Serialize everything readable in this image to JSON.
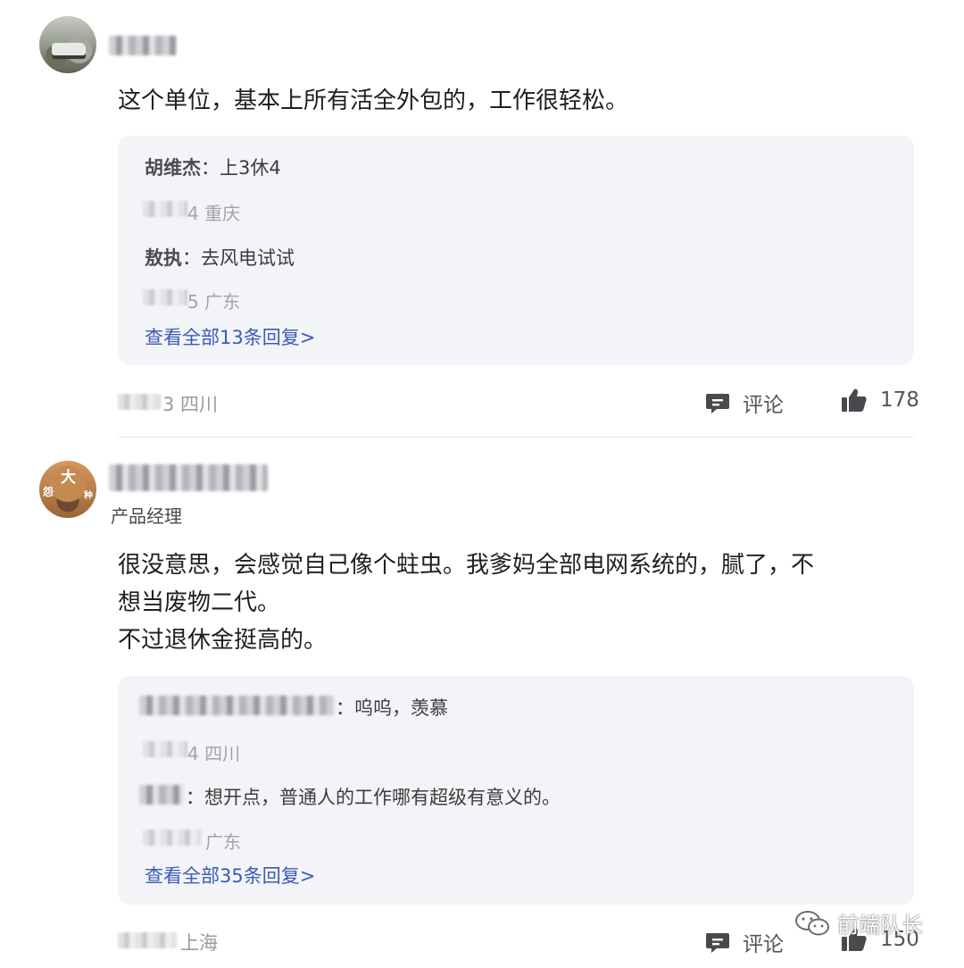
{
  "comments": [
    {
      "text": "这个单位，基本上所有活全外包的，工作很轻松。",
      "replies": [
        {
          "author": "胡维杰",
          "sep": "：",
          "text": "上3休4",
          "meta_tail": "4 重庆"
        },
        {
          "author": "敖执",
          "sep": "：",
          "text": "去风电试试",
          "meta_tail": "5 广东"
        }
      ],
      "view_all": "查看全部13条回复>",
      "meta_tail": "3 四川",
      "comment_label": "评论",
      "like_count": "178"
    },
    {
      "subtitle": "产品经理",
      "text": "很没意思，会感觉自己像个蛀虫。我爹妈全部电网系统的，腻了，不\n想当废物二代。\n不过退休金挺高的。",
      "replies": [
        {
          "sep": "：",
          "text": "呜呜，羡慕",
          "meta_tail": "4 四川"
        },
        {
          "sep": "：",
          "text": "想开点，普通人的工作哪有超级有意义的。",
          "meta_tail": "广东"
        }
      ],
      "view_all": "查看全部35条回复>",
      "meta_tail": "上海",
      "comment_label": "评论",
      "like_count": "150"
    }
  ],
  "avatar2_glyphs": [
    "大",
    "怨",
    "种"
  ],
  "watermark": "前端队长",
  "icons": {
    "comment": "comment-bubble-icon",
    "like": "thumbs-up-icon",
    "watermark": "wechat-icon"
  }
}
